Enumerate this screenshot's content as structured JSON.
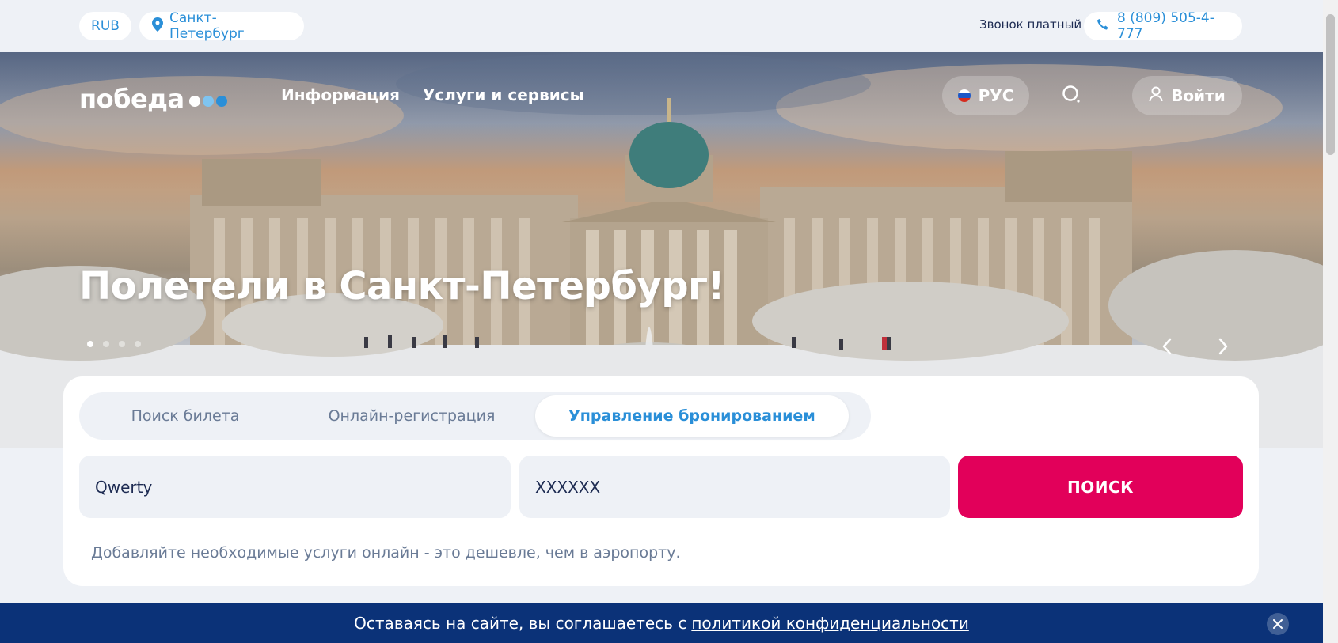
{
  "topbar": {
    "currency": "RUB",
    "city": "Санкт-Петербург",
    "call_note": "Звонок платный",
    "phone": "8 (809) 505-4-777"
  },
  "header": {
    "logo_text": "победа",
    "nav": [
      {
        "label": "Информация"
      },
      {
        "label": "Услуги и сервисы"
      }
    ],
    "language": "РУС",
    "login_label": "Войти"
  },
  "hero": {
    "title": "Полетели в Санкт-Петербург!",
    "slides_count": 4,
    "active_slide": 1
  },
  "booking": {
    "tabs": [
      {
        "label": "Поиск билета",
        "active": false
      },
      {
        "label": "Онлайн-регистрация",
        "active": false
      },
      {
        "label": "Управление бронированием",
        "active": true
      }
    ],
    "lastname_value": "Qwerty",
    "pnr_value": "XXXXXX",
    "search_label": "ПОИСК",
    "hint": "Добавляйте необходимые услуги онлайн - это дешевле, чем в аэропорту."
  },
  "cookie": {
    "text": "Оставаясь на сайте, вы соглашаетесь с",
    "link": "политикой конфиденциальности"
  },
  "colors": {
    "brand_blue": "#2a8fd8",
    "brand_magenta": "#e2005a",
    "navy": "#0b3278",
    "text": "#1d2b52",
    "muted": "#6a7b96"
  }
}
